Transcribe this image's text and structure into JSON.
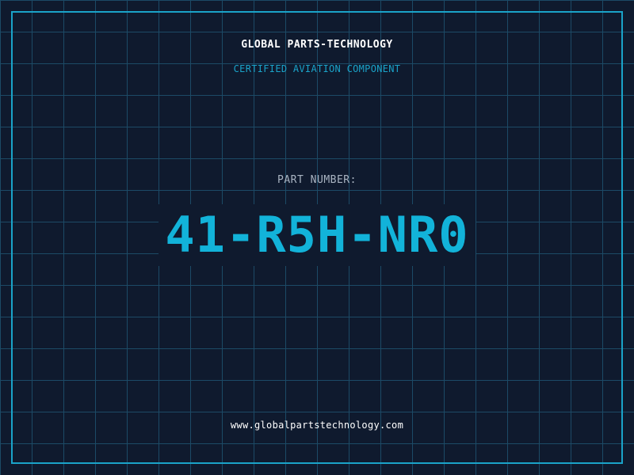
{
  "header": {
    "company": "GLOBAL PARTS-TECHNOLOGY",
    "subtitle": "CERTIFIED AVIATION COMPONENT"
  },
  "part": {
    "label": "PART NUMBER:",
    "number": "41-R5H-NR0"
  },
  "footer": {
    "url": "www.globalpartstechnology.com"
  },
  "colors": {
    "background": "#0f1a2e",
    "grid": "#1c4a66",
    "accent": "#1aa3c9",
    "part_number": "#12b3d9",
    "text": "#ffffff",
    "label": "#a9b4c2"
  }
}
